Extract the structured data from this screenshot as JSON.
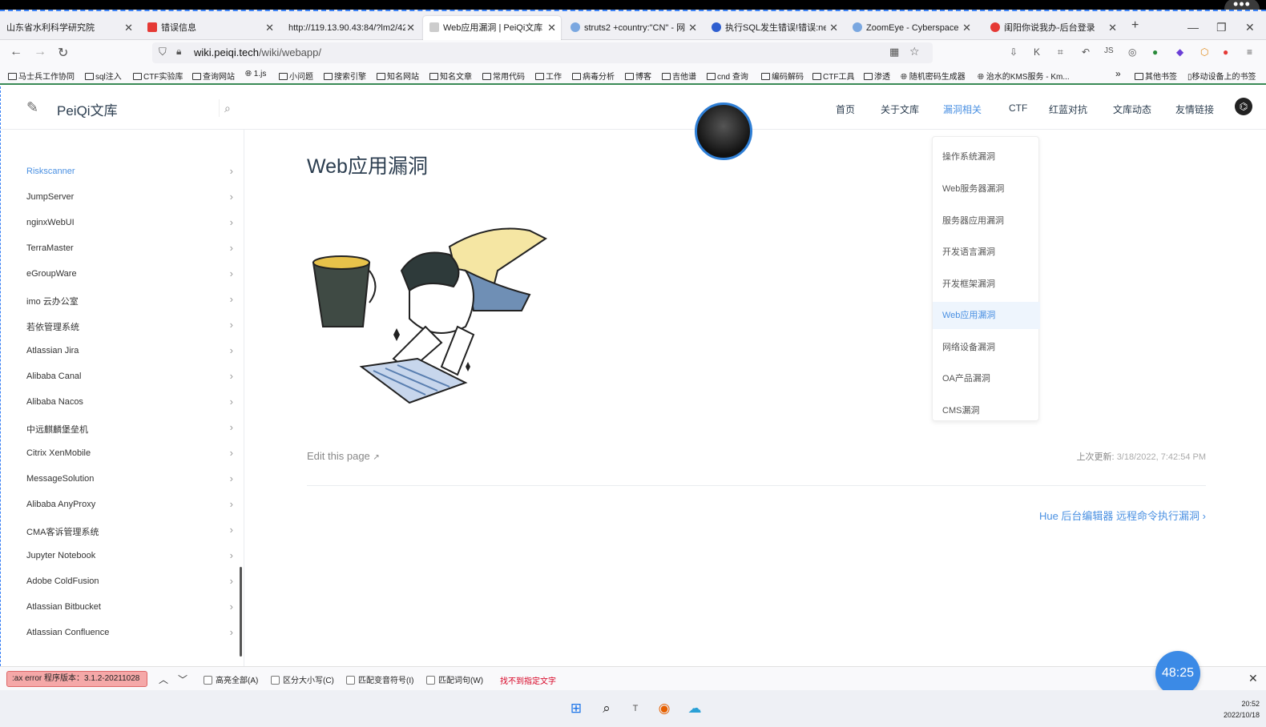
{
  "tabs": [
    {
      "title": "山东省水利科学研究院",
      "close": "✕",
      "color": "#3b82f6"
    },
    {
      "title": "错误信息",
      "close": "✕",
      "color": "#e53935"
    },
    {
      "title": "http://119.13.90.43:84/?lm2/42",
      "close": "✕",
      "color": ""
    },
    {
      "title": "Web应用漏洞 | PeiQi文库",
      "close": "✕",
      "color": "#888"
    },
    {
      "title": "struts2 +country:\"CN\" - 网",
      "close": "✕",
      "color": "#7aa7e0"
    },
    {
      "title": "执行SQL发生错误!错误:near",
      "close": "✕",
      "color": "#2f5fd0"
    },
    {
      "title": "ZoomEye - Cyberspace Sea",
      "close": "✕",
      "color": "#7aa7e0"
    },
    {
      "title": "闺阳你说我办-后台登录",
      "close": "✕",
      "color": "#e53935"
    }
  ],
  "tab_controls": {
    "new_tab": "+",
    "minimize": "—",
    "restore": "❐",
    "close": "✕"
  },
  "address": {
    "url_host": "wiki.peiqi.tech",
    "url_path": "/wiki/webapp/"
  },
  "toolbar": {
    "back": "←",
    "forward": "→",
    "reload": "↻",
    "extensions": [
      "⇩",
      "K",
      "⌗",
      "↶",
      "JS",
      "◎",
      "●",
      "◆",
      "⬡",
      "●",
      "≡"
    ]
  },
  "bookmarks": [
    "马士兵工作协同",
    "sql注入",
    "CTF实验库",
    "查询网站",
    "1.js",
    "小问题",
    "搜索引擎",
    "知名网站",
    "知名文章",
    "常用代码",
    "工作",
    "病毒分析",
    "博客",
    "吉他谱",
    "cnd 查询",
    "编码解码",
    "CTF工具",
    "渗透",
    "随机密码生成器",
    "治水的KMS服务 - Km...",
    "»",
    "其他书签",
    "移动设备上的书签"
  ],
  "site": {
    "title": "PeiQi文库"
  },
  "nav": [
    "首页",
    "关于文库",
    "漏洞相关",
    "CTF",
    "红蓝对抗",
    "文库动态",
    "友情链接"
  ],
  "dropdown": [
    "操作系统漏洞",
    "Web服务器漏洞",
    "服务器应用漏洞",
    "开发语言漏洞",
    "开发框架漏洞",
    "Web应用漏洞",
    "网络设备漏洞",
    "OA产品漏洞",
    "CMS漏洞"
  ],
  "sidebar": [
    "Riskscanner",
    "JumpServer",
    "nginxWebUI",
    "TerraMaster",
    "eGroupWare",
    "imo 云办公室",
    "若依管理系统",
    "Atlassian Jira",
    "Alibaba Canal",
    "Alibaba Nacos",
    "中远麒麟堡垒机",
    "Citrix XenMobile",
    "MessageSolution",
    "Alibaba AnyProxy",
    "CMA客诉管理系统",
    "Jupyter Notebook",
    "Adobe ColdFusion",
    "Atlassian Bitbucket",
    "Atlassian Confluence"
  ],
  "content": {
    "heading": "Web应用漏洞",
    "edit": "Edit this page",
    "updated_label": "上次更新:",
    "updated_value": "3/18/2022, 7:42:54 PM",
    "next": "Hue 后台编辑器 远程命令执行漏洞"
  },
  "findbar": {
    "input": ":ax error 程序版本：3.1.2-20211028",
    "options": [
      "高亮全部(A)",
      "区分大小写(C)",
      "匹配变音符号(I)",
      "匹配词句(W)"
    ],
    "status": "找不到指定文字"
  },
  "timer": "48:25",
  "clock": {
    "time": "20:52",
    "date": "2022/10/18"
  },
  "colors": {
    "accent": "#4a90e2",
    "findbar_error": "#d70022",
    "tab_indicator": "#3a8a56"
  }
}
